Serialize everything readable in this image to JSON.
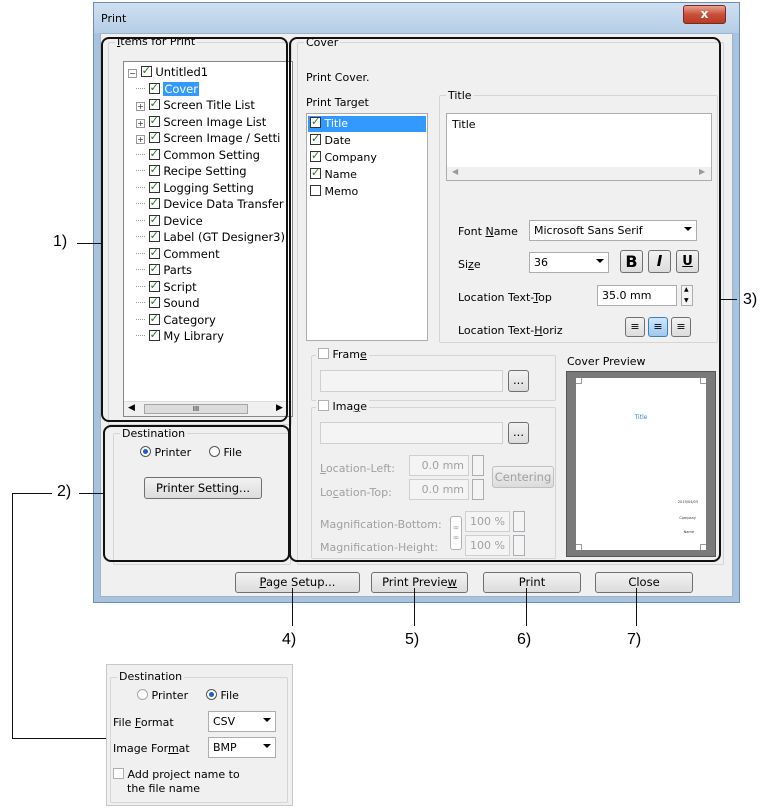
{
  "window": {
    "title": "Print",
    "close_glyph": "x"
  },
  "items_for_print": {
    "label": "Items for Print",
    "tree": [
      {
        "label": "Untitled1",
        "expander": "minus",
        "level": 0
      },
      {
        "label": "Cover",
        "expander": "",
        "level": 1,
        "selected": true
      },
      {
        "label": "Screen Title List",
        "expander": "plus",
        "level": 1
      },
      {
        "label": "Screen Image List",
        "expander": "plus",
        "level": 1
      },
      {
        "label": "Screen Image / Setti",
        "expander": "plus",
        "level": 1
      },
      {
        "label": "Common Setting",
        "expander": "",
        "level": 1
      },
      {
        "label": "Recipe Setting",
        "expander": "",
        "level": 1
      },
      {
        "label": "Logging Setting",
        "expander": "",
        "level": 1
      },
      {
        "label": "Device Data Transfer",
        "expander": "",
        "level": 1
      },
      {
        "label": "Device",
        "expander": "",
        "level": 1
      },
      {
        "label": "Label (GT Designer3)",
        "expander": "",
        "level": 1
      },
      {
        "label": "Comment",
        "expander": "",
        "level": 1
      },
      {
        "label": "Parts",
        "expander": "",
        "level": 1
      },
      {
        "label": "Script",
        "expander": "",
        "level": 1
      },
      {
        "label": "Sound",
        "expander": "",
        "level": 1
      },
      {
        "label": "Category",
        "expander": "",
        "level": 1
      },
      {
        "label": "My Library",
        "expander": "",
        "level": 1
      }
    ],
    "hscroll_thumb": "III"
  },
  "destination": {
    "label": "Destination",
    "printer_label": "Printer",
    "file_label": "File",
    "printer_setting_button": "Printer Setting..."
  },
  "cover": {
    "label": "Cover",
    "print_cover_label": "Print Cover.",
    "print_target_label": "Print Target",
    "targets": [
      {
        "label": "Title",
        "checked": true,
        "selected": true
      },
      {
        "label": "Date",
        "checked": true
      },
      {
        "label": "Company",
        "checked": true
      },
      {
        "label": "Name",
        "checked": true
      },
      {
        "label": "Memo",
        "checked": false
      }
    ],
    "title_group_label": "Title",
    "title_text": "Title",
    "font_name_label": "Font Name",
    "font_name_value": "Microsoft Sans Serif",
    "size_label": "Size",
    "size_value": "36",
    "bold_label": "B",
    "italic_label": "I",
    "underline_label": "U",
    "location_text_top_label": "Location Text-Top",
    "location_text_top_value": "35.0 mm",
    "location_text_horiz_label": "Location Text-Horiz",
    "frame_label": "Frame",
    "browse_label": "...",
    "image_label": "Image",
    "location_left_label": "Location-Left:",
    "location_left_value": "0.0 mm",
    "location_top_label": "Location-Top:",
    "location_top_value": "0.0 mm",
    "centering_button": "Centering",
    "mag_bottom_label": "Magnification-Bottom:",
    "mag_bottom_value": "100 %",
    "mag_height_label": "Magnification-Height:",
    "mag_height_value": "100 %",
    "cover_preview_label": "Cover Preview",
    "preview_title": "Title",
    "preview_date": "2019/04/03",
    "preview_company": "Company",
    "preview_name": "Name"
  },
  "buttons": {
    "page_setup": "Page Setup...",
    "print_preview": "Print Preview",
    "print": "Print",
    "close": "Close"
  },
  "callouts": {
    "c1": "1)",
    "c2": "2)",
    "c3": "3)",
    "c4": "4)",
    "c5": "5)",
    "c6": "6)",
    "c7": "7)"
  },
  "destination_file": {
    "label": "Destination",
    "printer_label": "Printer",
    "file_label": "File",
    "file_format_label": "File Format",
    "file_format_value": "CSV",
    "image_format_label": "Image Format",
    "image_format_value": "BMP",
    "add_project_name_line1": "Add project name to",
    "add_project_name_line2": "the file name"
  },
  "colors": {
    "selection": "#3399ff",
    "title_blue": "#3a7fd5",
    "window_frame": "#a9c3de"
  }
}
